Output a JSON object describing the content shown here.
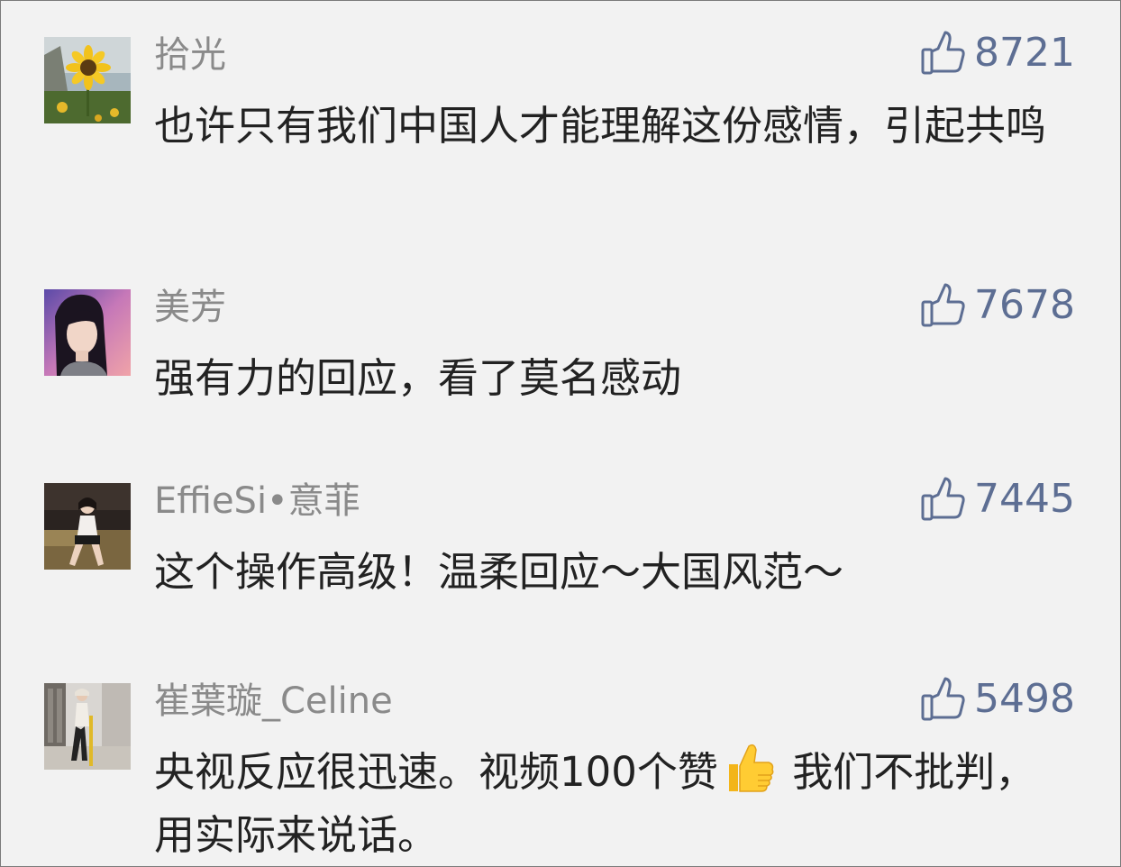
{
  "comments": [
    {
      "username": "拾光",
      "likes": "8721",
      "text": "也许只有我们中国人才能理解这份感情，引起共鸣",
      "avatar": "sunflower-avatar"
    },
    {
      "username": "美芳",
      "likes": "7678",
      "text": "强有力的回应，看了莫名感动",
      "avatar": "portrait-avatar"
    },
    {
      "username": "EffieSi•意菲",
      "likes": "7445",
      "text": "这个操作高级！温柔回应～大国风范～",
      "avatar": "seated-woman-avatar"
    },
    {
      "username": "崔葉璇_Celine",
      "likes": "5498",
      "text_before_emoji": "央视反应很迅速。视频100个赞",
      "text_after_emoji": " 我们不批判，用实际来说话。",
      "emoji": "thumbs-up-emoji",
      "avatar": "street-photo-avatar"
    }
  ],
  "colors": {
    "background": "#f2f2f2",
    "username": "#8a8a8a",
    "body_text": "#222222",
    "like_accent": "#5d6e93"
  }
}
